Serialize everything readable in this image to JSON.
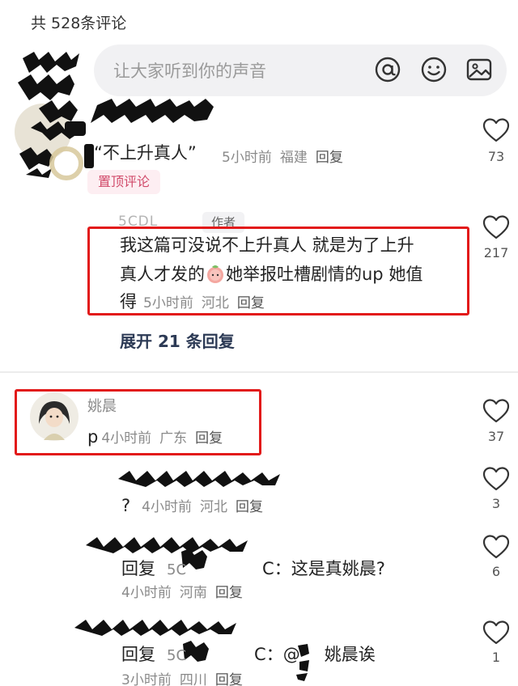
{
  "header": {
    "comment_count": "共 528条评论"
  },
  "search": {
    "placeholder": "让大家听到你的声音"
  },
  "icons": {
    "at": "at-icon",
    "emoji": "smiley-icon",
    "image": "image-icon",
    "like": "heart-outline-icon"
  },
  "colors": {
    "highlight_box": "#e21a1a",
    "pin_badge_text": "#d14a6a",
    "expand_text": "#2c3a55"
  },
  "comments": [
    {
      "name": "",
      "text": "“不上升真人”",
      "time": "5小时前",
      "location": "福建",
      "reply": "回复",
      "likes": "73",
      "badge": "置顶评论"
    },
    {
      "name": "5CDL",
      "author_badge": "作者",
      "text_line1": "我这篇可没说不上升真人 就是为了上升",
      "text_line2a": "真人才发的",
      "text_line2b": "她举报吐槽剧情的up 她值",
      "text_line3": "得",
      "time": "5小时前",
      "location": "河北",
      "reply": "回复",
      "likes": "217",
      "expand": "展开 21 条回复"
    },
    {
      "name": "姚晨",
      "text": "p",
      "time": "4小时前",
      "location": "广东",
      "reply": "回复",
      "likes": "37"
    },
    {
      "text": "?",
      "time": "4小时前",
      "location": "河北",
      "reply": "回复",
      "likes": "3"
    },
    {
      "text_prefix": "回复",
      "text_mid": "5C",
      "text_tail": "C：这是真姚晨?",
      "time": "4小时前",
      "location": "河南",
      "reply": "回复",
      "likes": "6"
    },
    {
      "text_prefix": "回复",
      "text_mid": "5C",
      "text_tail": "C：@",
      "text_end": "姚晨诶",
      "time": "3小时前",
      "location": "四川",
      "reply": "回复",
      "likes": "1"
    }
  ]
}
